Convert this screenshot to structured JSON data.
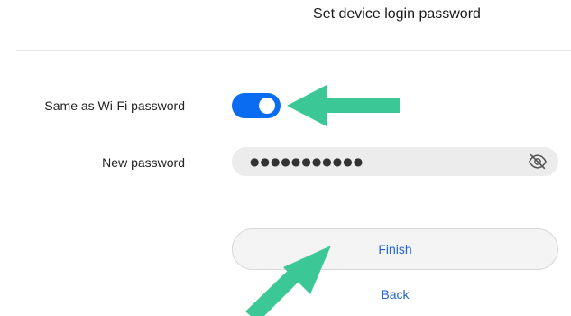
{
  "header": {
    "title": "Set device login password"
  },
  "form": {
    "same_as_wifi_label": "Same as Wi-Fi password",
    "same_as_wifi_on": true,
    "new_password_label": "New password",
    "new_password_value": "●●●●●●●●●●●",
    "eye_icon": "eye-slash-icon"
  },
  "actions": {
    "finish_label": "Finish",
    "back_label": "Back"
  },
  "colors": {
    "toggle_on": "#0a6cf0",
    "link_blue": "#1f63d6",
    "annotation_arrow": "#3cc896"
  }
}
